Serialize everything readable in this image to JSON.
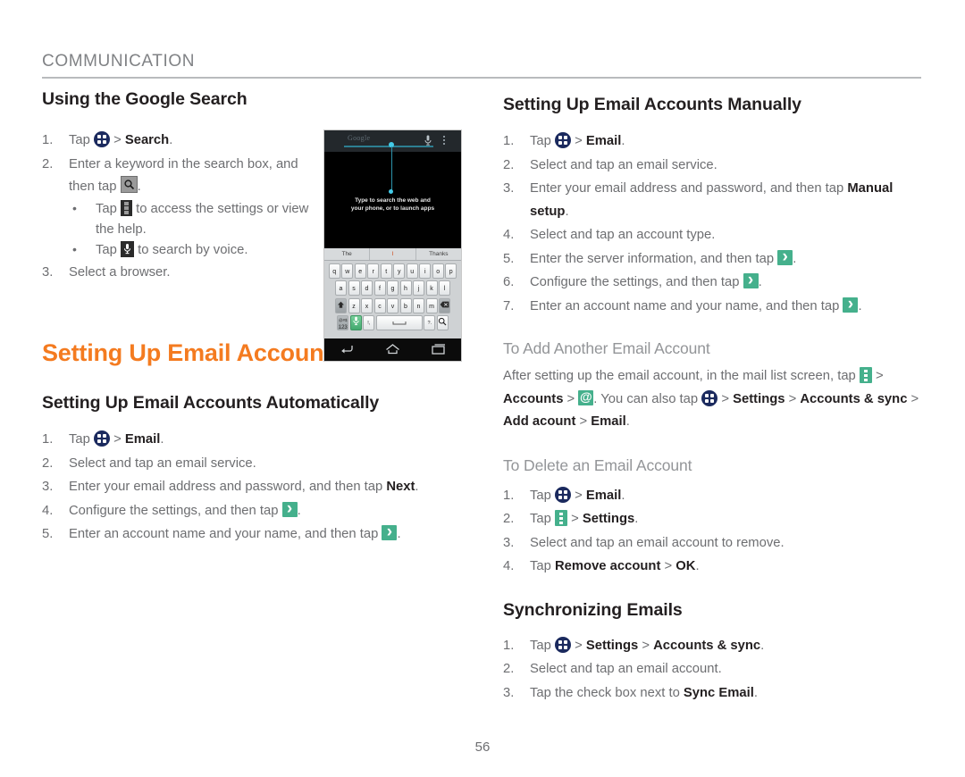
{
  "running_head": "COMMUNICATION",
  "page_number": "56",
  "colors": {
    "chapter_accent": "#f47b20",
    "heading": "#231f20",
    "body": "#6d6e71",
    "subhead": "#939598",
    "icon_green": "#45b08c",
    "icon_navy": "#1b2a5e",
    "rule": "#b9bbbd"
  },
  "left_column": {
    "section1": {
      "title": "Using the Google Search",
      "steps": [
        {
          "num": "1.",
          "before": "Tap ",
          "icon": "apps-icon",
          "after_icon": " > ",
          "bold": "Search",
          "tail": "."
        },
        {
          "num": "2.",
          "before": "Enter a keyword in the search box, and then tap ",
          "icon": "search-gray-icon",
          "after_icon": "",
          "bold": "",
          "tail": "."
        },
        {
          "num": "3.",
          "before": "Select a browser.",
          "icon": "",
          "after_icon": "",
          "bold": "",
          "tail": ""
        }
      ],
      "bullets": [
        {
          "before": "Tap ",
          "icon": "overflow-menu-dark-icon",
          "after": " to access the settings or view the help."
        },
        {
          "before": "Tap ",
          "icon": "microphone-dark-icon",
          "after": " to search by voice."
        }
      ]
    },
    "chapter_title": "Setting Up Email Accounts",
    "section2": {
      "title": "Setting Up Email Accounts Automatically",
      "steps": [
        {
          "num": "1.",
          "text": "Tap ",
          "icon": "apps-icon",
          "sep": " > ",
          "bold": "Email",
          "tail": "."
        },
        {
          "num": "2.",
          "text": "Select and tap an email service.",
          "icon": "",
          "sep": "",
          "bold": "",
          "tail": ""
        },
        {
          "num": "3.",
          "text": "Enter your email address and password, and then tap ",
          "icon": "",
          "sep": "",
          "bold": "Next",
          "tail": "."
        },
        {
          "num": "4.",
          "text": "Configure the settings, and then tap ",
          "icon": "next-arrow-icon",
          "sep": "",
          "bold": "",
          "tail": "."
        },
        {
          "num": "5.",
          "text": "Enter an account name and your name, and then tap ",
          "icon": "next-arrow-icon",
          "sep": "",
          "bold": "",
          "tail": "."
        }
      ]
    }
  },
  "right_column": {
    "section1": {
      "title": "Setting Up Email Accounts Manually",
      "steps": [
        {
          "num": "1.",
          "text": "Tap ",
          "icon": "apps-icon",
          "sep": " > ",
          "bold": "Email",
          "tail": "."
        },
        {
          "num": "2.",
          "text": "Select and tap an email service.",
          "icon": "",
          "sep": "",
          "bold": "",
          "tail": ""
        },
        {
          "num": "3.",
          "text": "Enter your email address and password, and then tap ",
          "icon": "",
          "sep": "",
          "bold": "Manual setup",
          "tail": "."
        },
        {
          "num": "4.",
          "text": "Select and tap an account type.",
          "icon": "",
          "sep": "",
          "bold": "",
          "tail": ""
        },
        {
          "num": "5.",
          "text": "Enter the server information, and then tap ",
          "icon": "next-arrow-icon",
          "sep": "",
          "bold": "",
          "tail": "."
        },
        {
          "num": "6.",
          "text": "Configure the settings, and then tap ",
          "icon": "next-arrow-icon",
          "sep": "",
          "bold": "",
          "tail": "."
        },
        {
          "num": "7.",
          "text": "Enter an account name and your name, and then tap ",
          "icon": "next-arrow-icon",
          "sep": "",
          "bold": "",
          "tail": "."
        }
      ]
    },
    "add_account": {
      "title": "To Add Another Email Account",
      "para_1": "After setting up the email account, in the mail list screen, tap ",
      "para_2": " > ",
      "bold_accounts": "Accounts",
      "para_3": " > ",
      "para_4": ". You can also tap ",
      "para_5": " > ",
      "bold_settings": "Settings",
      "para_6": " > ",
      "bold_accounts_sync": "Accounts & sync",
      "para_7": " > ",
      "bold_add_account": "Add acount",
      "para_8": " > ",
      "bold_email": "Email",
      "para_9": "."
    },
    "delete_account": {
      "title": "To Delete an Email Account",
      "steps": [
        {
          "num": "1.",
          "text": "Tap ",
          "icon": "apps-icon",
          "sep": " > ",
          "bold": "Email",
          "tail": "."
        },
        {
          "num": "2.",
          "text": "Tap ",
          "icon": "overflow-menu-green-icon",
          "sep": " > ",
          "bold": "Settings",
          "tail": "."
        },
        {
          "num": "3.",
          "text": "Select and tap an email account to remove.",
          "icon": "",
          "sep": "",
          "bold": "",
          "tail": ""
        },
        {
          "num": "4.",
          "text": "Tap ",
          "icon": "",
          "sep": "",
          "bold": "Remove account",
          "tail": "",
          "bold2": "OK",
          "sep2": " > ",
          "tail2": "."
        }
      ]
    },
    "sync": {
      "title": "Synchronizing Emails",
      "steps": [
        {
          "num": "1.",
          "text": "Tap ",
          "icon": "apps-icon",
          "sep": " > ",
          "bold": "Settings",
          "sep2": " > ",
          "bold2": "Accounts & sync",
          "tail": "."
        },
        {
          "num": "2.",
          "text": "Select and tap an email account.",
          "icon": "",
          "sep": "",
          "bold": "",
          "tail": ""
        },
        {
          "num": "3.",
          "text": "Tap the check box next to ",
          "icon": "",
          "sep": "",
          "bold": "Sync Email",
          "tail": "."
        }
      ]
    }
  },
  "phone_screenshot": {
    "search_placeholder": "Google",
    "hint_line1": "Type to search the web and",
    "hint_line2": "your phone, or to launch apps",
    "suggestions": [
      "The",
      "I",
      "Thanks"
    ],
    "keyboard_row1": [
      "q",
      "w",
      "e",
      "r",
      "t",
      "y",
      "u",
      "i",
      "o",
      "p"
    ],
    "keyboard_row2": [
      "a",
      "s",
      "d",
      "f",
      "g",
      "h",
      "j",
      "k",
      "l"
    ],
    "keyboard_row3": [
      "z",
      "x",
      "c",
      "v",
      "b",
      "n",
      "m"
    ],
    "keyboard_numeric_label": "123",
    "keyboard_symbol_label": "@#$",
    "key_comma": "!,",
    "key_period": "?."
  }
}
